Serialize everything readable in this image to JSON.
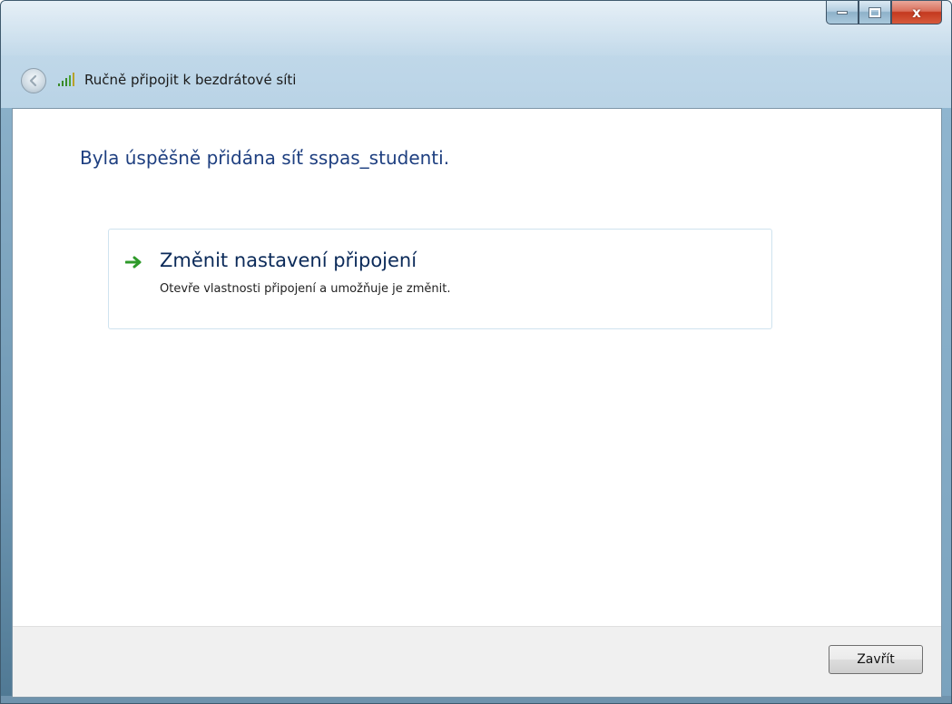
{
  "window": {
    "title": "Ručně připojit k bezdrátové síti",
    "close_glyph": "x",
    "icons": {
      "back": "back-arrow-icon",
      "network": "wireless-signal-icon",
      "minimize": "minimize-icon",
      "maximize": "maximize-icon",
      "close": "close-icon"
    }
  },
  "content": {
    "heading": "Byla úspěšně přidána síť sspas_studenti.",
    "option": {
      "title": "Změnit nastavení připojení",
      "description": "Otevře vlastnosti připojení a umožňuje je změnit.",
      "icon": "green-arrow-icon"
    }
  },
  "footer": {
    "close_label": "Zavřít"
  },
  "colors": {
    "heading": "#1e3f80",
    "option_title": "#0b2a59",
    "arrow": "#2e9a2a",
    "close_button": "#c4391f"
  }
}
